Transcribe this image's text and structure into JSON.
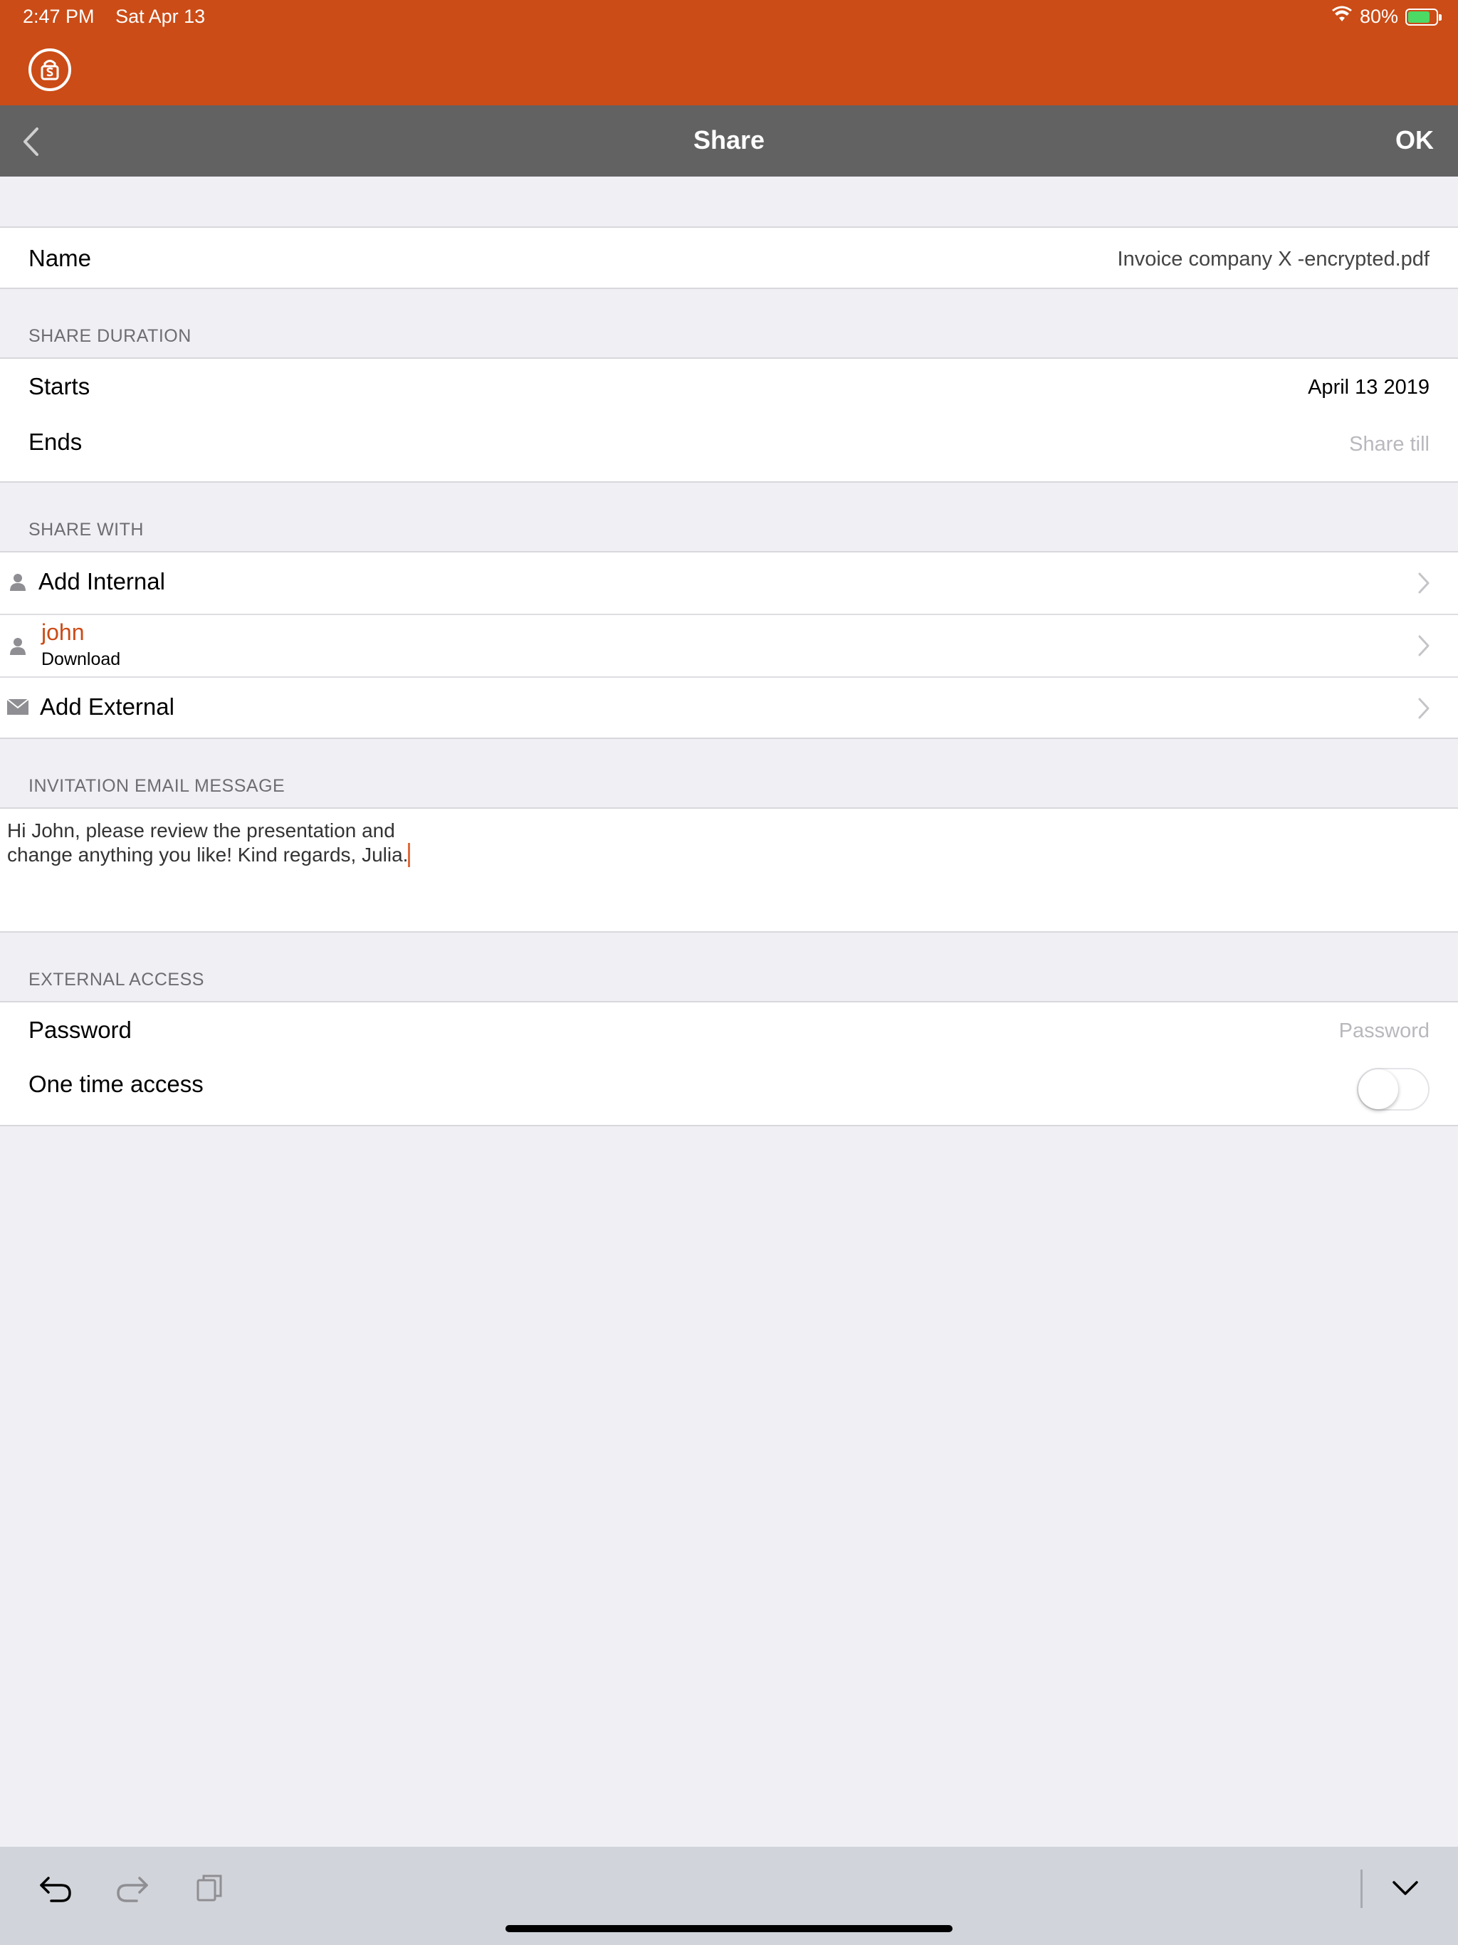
{
  "status_bar": {
    "time": "2:47 PM",
    "date": "Sat Apr 13",
    "battery": "80%",
    "battery_level": 0.8,
    "wifi_icon": "wifi-icon",
    "battery_icon": "battery-charging-icon"
  },
  "app": {
    "logo_icon": "app-logo-icon",
    "brand_color": "#cb4c17"
  },
  "nav": {
    "back_icon": "chevron-left-icon",
    "title": "Share",
    "ok_label": "OK"
  },
  "name_row": {
    "label": "Name",
    "value": "Invoice company X -encrypted.pdf"
  },
  "share_duration": {
    "header": "SHARE DURATION",
    "starts_label": "Starts",
    "starts_value": "April 13 2019",
    "ends_label": "Ends",
    "ends_placeholder": "Share till"
  },
  "share_with": {
    "header": "SHARE WITH",
    "add_internal": "Add Internal",
    "user_name": "john",
    "user_permission": "Download",
    "add_external": "Add External"
  },
  "invitation": {
    "header": "INVITATION EMAIL MESSAGE",
    "line1": "Hi John, please review the presentation and",
    "line2": "change anything you like! Kind regards, Julia."
  },
  "external_access": {
    "header": "EXTERNAL ACCESS",
    "password_label": "Password",
    "password_placeholder": "Password",
    "one_time_label": "One time access",
    "one_time_enabled": false
  },
  "keyboard_toolbar": {
    "undo_icon": "undo-icon",
    "redo_icon": "redo-icon",
    "paste_icon": "paste-icon",
    "dismiss_icon": "chevron-down-icon"
  }
}
